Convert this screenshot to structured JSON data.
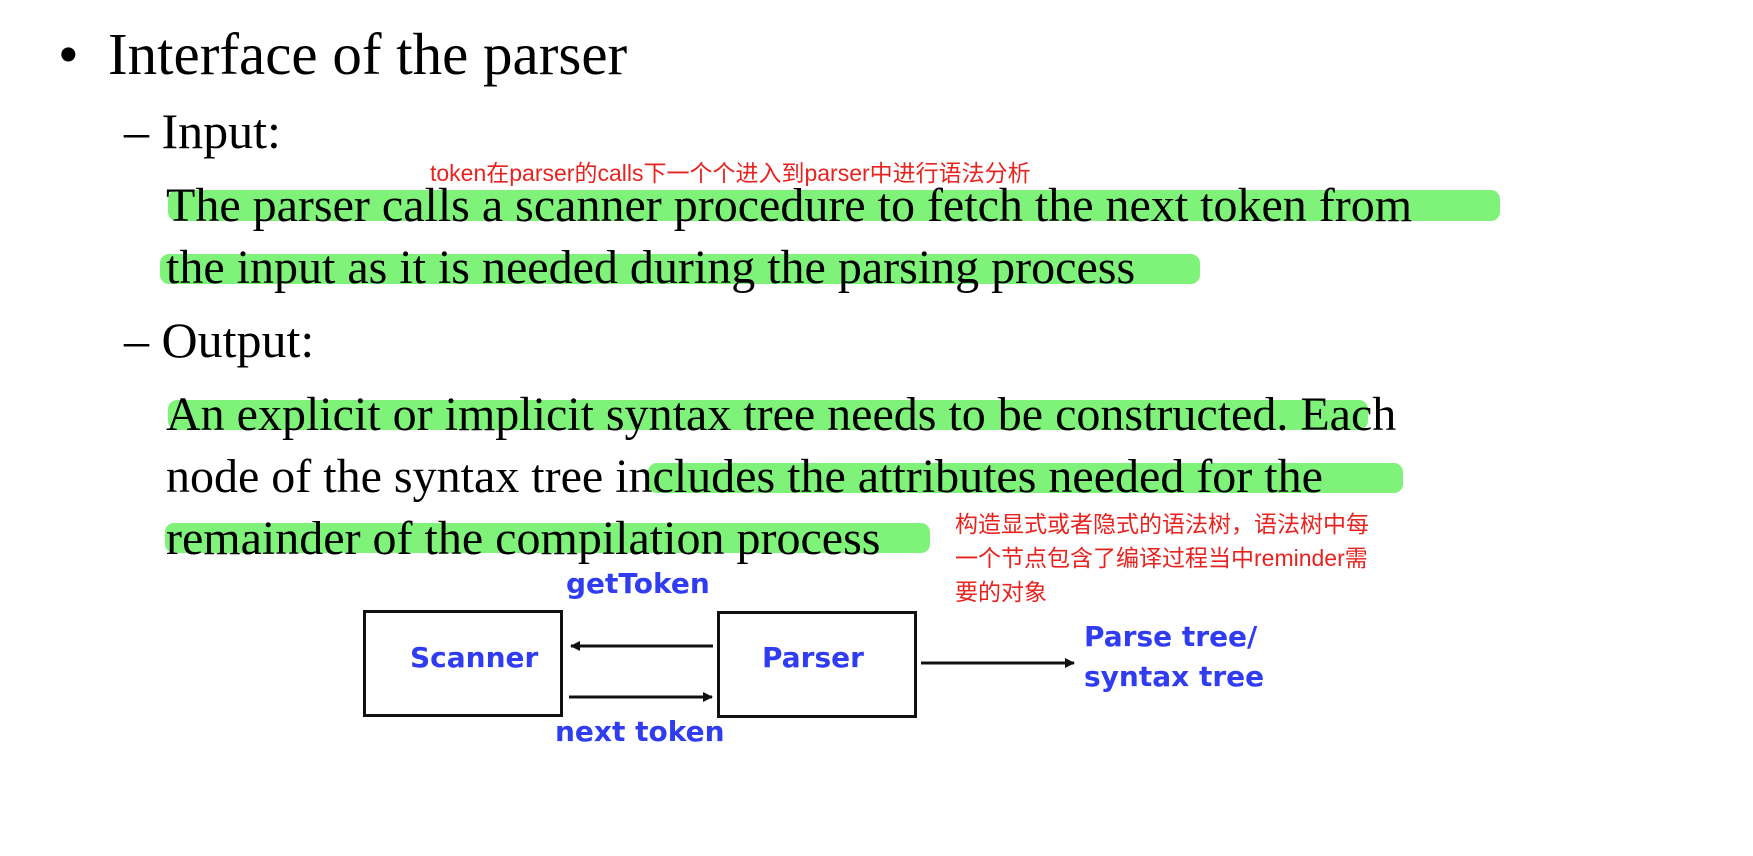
{
  "slide": {
    "bullet_glyph": "•",
    "title": "Interface of the parser",
    "input": {
      "heading": "– Input:",
      "line1": "The parser calls a scanner procedure to fetch the next token from",
      "line2": "the input as it is needed during the parsing process"
    },
    "output": {
      "heading": "– Output:",
      "line1_part1": "An explicit or implicit syntax tree needs to be constructed.",
      "line1_part2": " Each",
      "line2_part1": "node of the syntax tree ",
      "line2_part2": "includes the attributes needed for the",
      "line3": "remainder of the compilation process"
    }
  },
  "annotations": {
    "input_note": "token在parser的calls下一个个进入到parser中进行语法分析",
    "output_note_line1": "构造显式或者隐式的语法树，语法树中每",
    "output_note_line2": "一个节点包含了编译过程当中reminder需",
    "output_note_line3": "要的对象"
  },
  "diagram": {
    "scanner_label": "Scanner",
    "parser_label": "Parser",
    "get_token_label": "getToken",
    "next_token_label": "next token",
    "output_label_line1": "Parse tree/",
    "output_label_line2": "syntax tree"
  },
  "colors": {
    "highlight": "#7ff27a",
    "annotation": "#e8231f",
    "diagram_text": "#2f3cf2"
  }
}
